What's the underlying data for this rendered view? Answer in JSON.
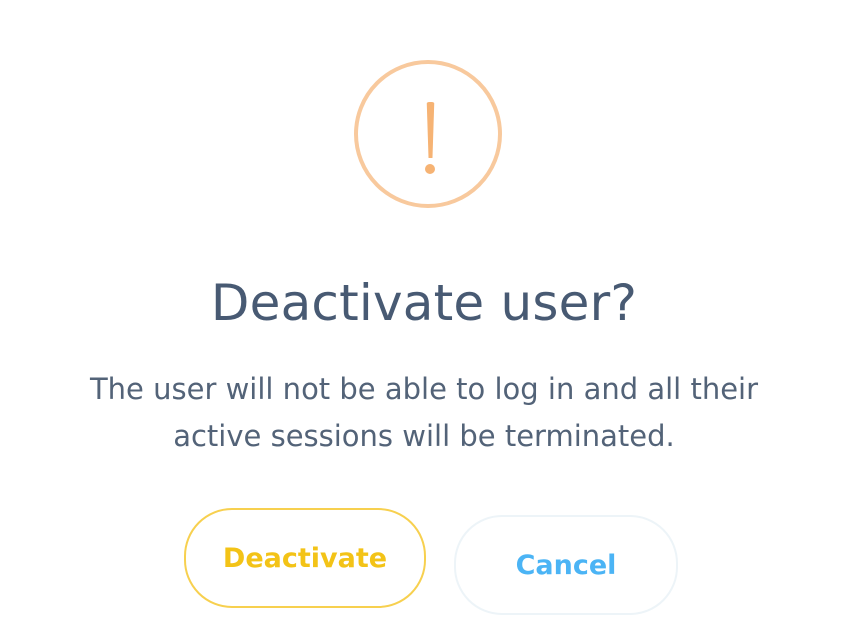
{
  "dialog": {
    "icon": "warning-exclamation-icon",
    "title": "Deactivate user?",
    "message_lines": [
      "The user will not be able to log in and all their",
      "active sessions will be terminated."
    ],
    "buttons": {
      "deactivate_label": "Deactivate",
      "cancel_label": "Cancel"
    }
  },
  "colors": {
    "warning": "#f8c99d",
    "title": "#485a73",
    "text": "#536378",
    "deactivate": "#f3c317",
    "cancel": "#4bb4f5"
  }
}
